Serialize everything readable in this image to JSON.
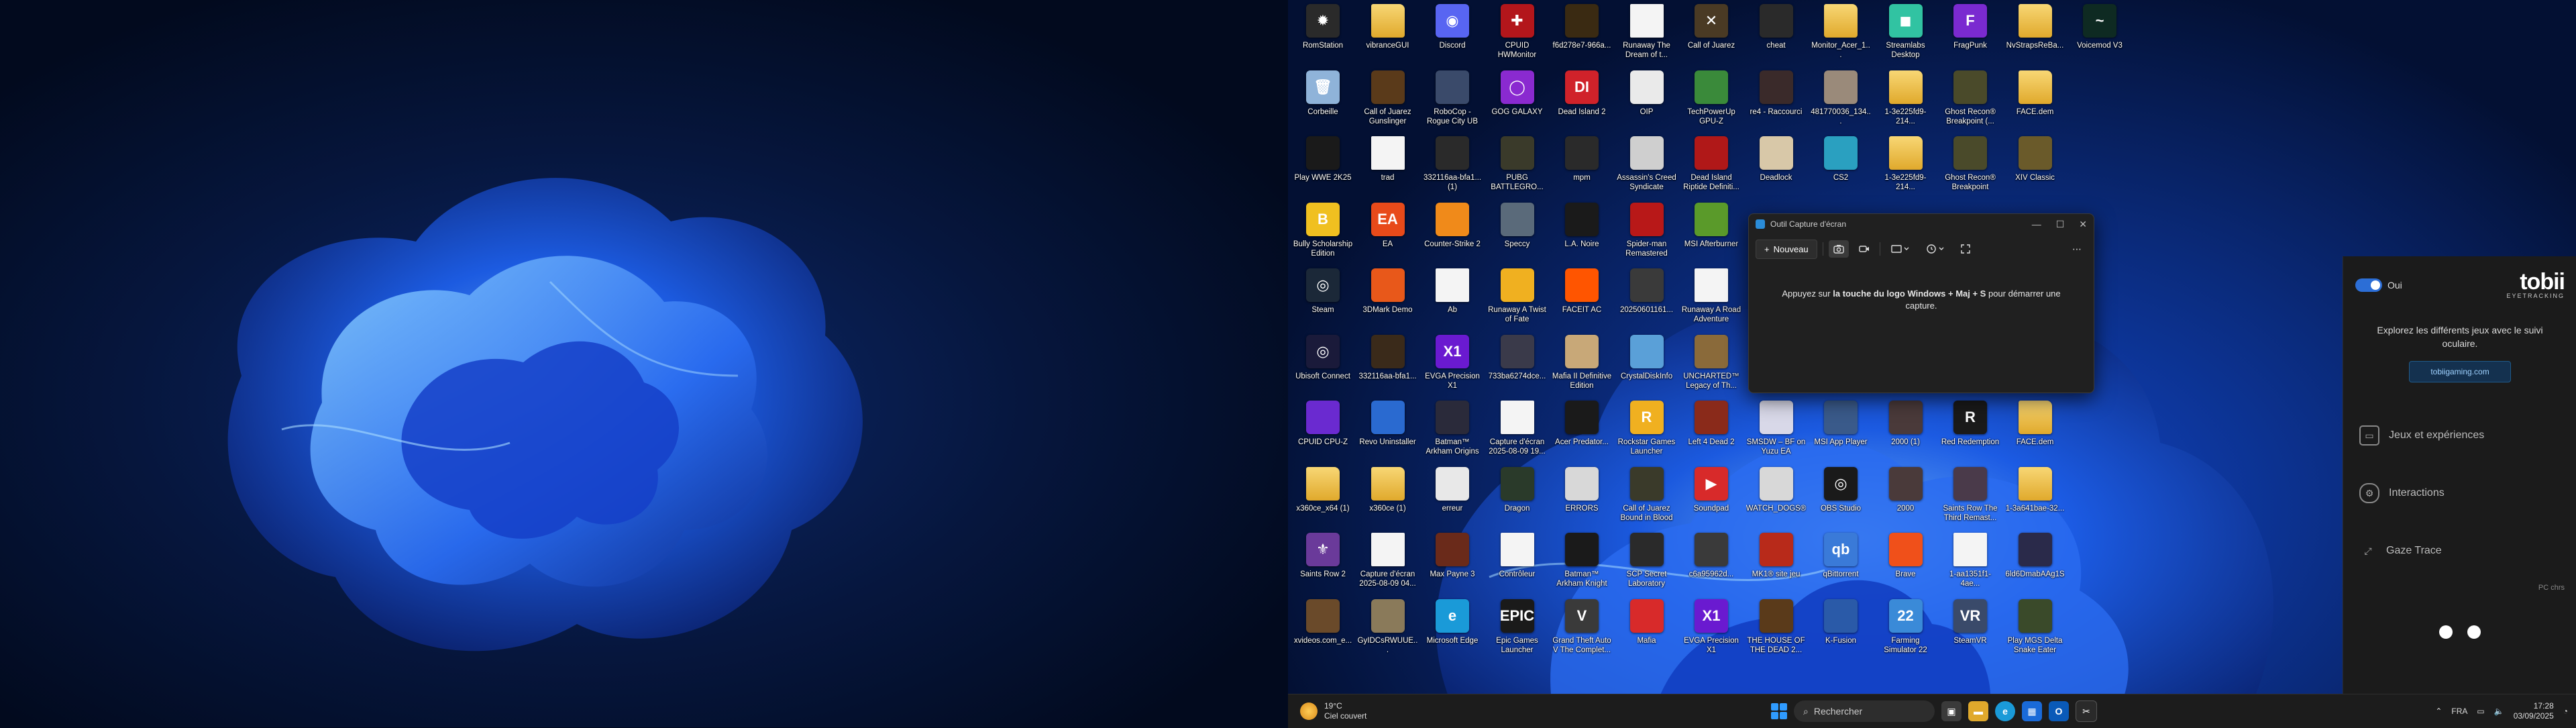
{
  "desktop_icons": [
    {
      "label": "RomStation",
      "color": "#2a2a2a",
      "glyph": "✹"
    },
    {
      "label": "vibranceGUI",
      "color": "#e0a92c",
      "glyph": "",
      "kind": "folder"
    },
    {
      "label": "Discord",
      "color": "#5865f2",
      "glyph": "◉"
    },
    {
      "label": "CPUID HWMonitor",
      "color": "#b3161b",
      "glyph": "✚"
    },
    {
      "label": "f6d278e7-966a...",
      "color": "#3a2a12",
      "glyph": ""
    },
    {
      "label": "Runaway The Dream of t...",
      "color": "#f4f4f4",
      "glyph": "",
      "kind": "doc"
    },
    {
      "label": "Call of Juarez",
      "color": "#4a3a24",
      "glyph": "✕"
    },
    {
      "label": "cheat",
      "color": "#2a2a2a",
      "glyph": ""
    },
    {
      "label": "Monitor_Acer_1...",
      "color": "#e0a92c",
      "glyph": "",
      "kind": "folder"
    },
    {
      "label": "Streamlabs Desktop",
      "color": "#31c3a2",
      "glyph": "◼"
    },
    {
      "label": "FragPunk",
      "color": "#7a2ad0",
      "glyph": "F"
    },
    {
      "label": "NvStrapsReBa...",
      "color": "#e0a92c",
      "glyph": "",
      "kind": "folder"
    },
    {
      "label": "Voicemod V3",
      "color": "#0e2a22",
      "glyph": "~"
    },
    {
      "label": "Corbeille",
      "color": "#8fb3d9",
      "glyph": "🗑"
    },
    {
      "label": "Call of Juarez Gunslinger",
      "color": "#5a3a1a",
      "glyph": ""
    },
    {
      "label": "RoboCop - Rogue City UB",
      "color": "#3a4a6a",
      "glyph": ""
    },
    {
      "label": "GOG GALAXY",
      "color": "#8a2ad0",
      "glyph": "◯"
    },
    {
      "label": "Dead Island 2",
      "color": "#d0222a",
      "glyph": "DI"
    },
    {
      "label": "OIP",
      "color": "#eaeaea",
      "glyph": ""
    },
    {
      "label": "TechPowerUp GPU-Z",
      "color": "#3a8a3a",
      "glyph": ""
    },
    {
      "label": "re4 - Raccourci",
      "color": "#3a2a2a",
      "glyph": ""
    },
    {
      "label": "481770036_134...",
      "color": "#9a8a7a",
      "glyph": ""
    },
    {
      "label": "1-3e225fd9-214...",
      "color": "#e0a92c",
      "glyph": "",
      "kind": "folder"
    },
    {
      "label": "Ghost Recon® Breakpoint (...",
      "color": "#4a4a2a",
      "glyph": ""
    },
    {
      "label": "FACE.dem",
      "color": "#e0a92c",
      "glyph": "",
      "kind": "folder"
    },
    {
      "label": "Play WWE 2K25",
      "color": "#1a1a1a",
      "glyph": ""
    },
    {
      "label": "trad",
      "color": "#f4f4f4",
      "glyph": "",
      "kind": "doc"
    },
    {
      "label": "332116aa-bfa1... (1)",
      "color": "#2a2a2a",
      "glyph": ""
    },
    {
      "label": "PUBG BATTLEGRO...",
      "color": "#3a3a2a",
      "glyph": ""
    },
    {
      "label": "mpm",
      "color": "#2a2a2a",
      "glyph": ""
    },
    {
      "label": "Assassin's Creed Syndicate",
      "color": "#cfcfcf",
      "glyph": ""
    },
    {
      "label": "Dead Island Riptide Definiti...",
      "color": "#b01818",
      "glyph": ""
    },
    {
      "label": "Deadlock",
      "color": "#d8c8a8",
      "glyph": ""
    },
    {
      "label": "CS2",
      "color": "#2aa0c0",
      "glyph": ""
    },
    {
      "label": "1-3e225fd9-214...",
      "color": "#e0a92c",
      "glyph": "",
      "kind": "folder"
    },
    {
      "label": "Ghost Recon® Breakpoint",
      "color": "#4a4a2a",
      "glyph": ""
    },
    {
      "label": "XIV Classic",
      "color": "#6a5a2a",
      "glyph": ""
    },
    {
      "label": "Bully Scholarship Edition",
      "color": "#f0c020",
      "glyph": "B"
    },
    {
      "label": "EA",
      "color": "#e84a1a",
      "glyph": "EA"
    },
    {
      "label": "Counter-Strike 2",
      "color": "#f08a1a",
      "glyph": ""
    },
    {
      "label": "Speccy",
      "color": "#5a6a7a",
      "glyph": ""
    },
    {
      "label": "L.A. Noire",
      "color": "#1a1a1a",
      "glyph": ""
    },
    {
      "label": "Spider-man Remastered",
      "color": "#b81818",
      "glyph": ""
    },
    {
      "label": "MSI Afterburner",
      "color": "#5a9a2a",
      "glyph": ""
    },
    {
      "label": "Steam",
      "color": "#1b2838",
      "glyph": "◎"
    },
    {
      "label": "3DMark Demo",
      "color": "#e8581a",
      "glyph": ""
    },
    {
      "label": "Ab",
      "color": "#f4f4f4",
      "glyph": "",
      "kind": "doc"
    },
    {
      "label": "Runaway A Twist of Fate",
      "color": "#f0b020",
      "glyph": ""
    },
    {
      "label": "FACEIT AC",
      "color": "#ff5500",
      "glyph": ""
    },
    {
      "label": "20250601161...",
      "color": "#3a3a3a",
      "glyph": ""
    },
    {
      "label": "Runaway A Road Adventure",
      "color": "#f4f4f4",
      "glyph": "",
      "kind": "doc"
    },
    {
      "label": "Ubisoft Connect",
      "color": "#1a1a3a",
      "glyph": "◎"
    },
    {
      "label": "332116aa-bfa1...",
      "color": "#3a2a1a",
      "glyph": ""
    },
    {
      "label": "EVGA Precision X1",
      "color": "#6a1ad0",
      "glyph": "X1"
    },
    {
      "label": "733ba6274dce...",
      "color": "#3a3a4a",
      "glyph": ""
    },
    {
      "label": "Mafia II Definitive Edition",
      "color": "#c8a878",
      "glyph": ""
    },
    {
      "label": "CrystalDiskInfo",
      "color": "#5aa0d8",
      "glyph": ""
    },
    {
      "label": "UNCHARTED™ Legacy of Th...",
      "color": "#8a6a3a",
      "glyph": ""
    },
    {
      "label": "CPUID CPU-Z",
      "color": "#6a2ad0",
      "glyph": ""
    },
    {
      "label": "Revo Uninstaller",
      "color": "#2a6ad0",
      "glyph": ""
    },
    {
      "label": "Batman™ Arkham Origins",
      "color": "#2a2a3a",
      "glyph": ""
    },
    {
      "label": "Capture d'écran 2025-08-09 19...",
      "color": "#f4f4f4",
      "glyph": "",
      "kind": "doc"
    },
    {
      "label": "Acer Predator...",
      "color": "#1a1a1a",
      "glyph": ""
    },
    {
      "label": "Rockstar Games Launcher",
      "color": "#f0b020",
      "glyph": "R"
    },
    {
      "label": "Left 4 Dead 2",
      "color": "#8a2a1a",
      "glyph": ""
    },
    {
      "label": "SMSDW – BF on Yuzu EA",
      "color": "#d8d8e8",
      "glyph": ""
    },
    {
      "label": "MSI App Player",
      "color": "#3a5a8a",
      "glyph": ""
    },
    {
      "label": "2000 (1)",
      "color": "#4a3a3a",
      "glyph": ""
    },
    {
      "label": "Red Redemption",
      "color": "#1a1a1a",
      "glyph": "R"
    },
    {
      "label": "FACE.dem",
      "color": "#e0a92c",
      "glyph": "",
      "kind": "folder"
    },
    {
      "label": "x360ce_x64 (1)",
      "color": "#e0a92c",
      "glyph": "",
      "kind": "folder"
    },
    {
      "label": "x360ce (1)",
      "color": "#e0a92c",
      "glyph": "",
      "kind": "folder"
    },
    {
      "label": "erreur",
      "color": "#e8e8e8",
      "glyph": ""
    },
    {
      "label": "Dragon",
      "color": "#2a3a2a",
      "glyph": ""
    },
    {
      "label": "ERRORS",
      "color": "#d8d8d8",
      "glyph": ""
    },
    {
      "label": "Call of Juarez Bound in Blood",
      "color": "#3a3a2a",
      "glyph": ""
    },
    {
      "label": "Soundpad",
      "color": "#d82a2a",
      "glyph": "▶"
    },
    {
      "label": "WATCH_DOGS®",
      "color": "#d8d8d8",
      "glyph": ""
    },
    {
      "label": "OBS Studio",
      "color": "#1a1a1a",
      "glyph": "◎"
    },
    {
      "label": "2000",
      "color": "#4a3a3a",
      "glyph": ""
    },
    {
      "label": "Saints Row The Third Remast...",
      "color": "#4a3a4a",
      "glyph": ""
    },
    {
      "label": "1-3a641bae-32...",
      "color": "#e0a92c",
      "glyph": "",
      "kind": "folder"
    },
    {
      "label": "Saints Row 2",
      "color": "#6a3a9a",
      "glyph": "⚜"
    },
    {
      "label": "Capture d'écran 2025-08-09 04...",
      "color": "#f4f4f4",
      "glyph": "",
      "kind": "doc"
    },
    {
      "label": "Max Payne 3",
      "color": "#6a2a1a",
      "glyph": ""
    },
    {
      "label": "Contrôleur",
      "color": "#f4f4f4",
      "glyph": "",
      "kind": "doc"
    },
    {
      "label": "Batman™ Arkham Knight",
      "color": "#1a1a1a",
      "glyph": ""
    },
    {
      "label": "SCP Secret Laboratory",
      "color": "#2a2a2a",
      "glyph": ""
    },
    {
      "label": "c6a95962d...",
      "color": "#3a3a3a",
      "glyph": ""
    },
    {
      "label": "MK1® site jeu",
      "color": "#b82a1a",
      "glyph": ""
    },
    {
      "label": "qBittorrent",
      "color": "#3a7ad8",
      "glyph": "qb"
    },
    {
      "label": "Brave",
      "color": "#f0501a",
      "glyph": ""
    },
    {
      "label": "1-aa1351f1-4ae...",
      "color": "#f4f4f4",
      "glyph": "",
      "kind": "doc"
    },
    {
      "label": "6ld6DmabAAg1S",
      "color": "#2a2a4a",
      "glyph": ""
    },
    {
      "label": "xvideos.com_e...",
      "color": "#6a4a2a",
      "glyph": ""
    },
    {
      "label": "GyIDCsRWUUE...",
      "color": "#8a7a5a",
      "glyph": ""
    },
    {
      "label": "Microsoft Edge",
      "color": "#1a9ad8",
      "glyph": "e"
    },
    {
      "label": "Epic Games Launcher",
      "color": "#1a1a1a",
      "glyph": "EPIC"
    },
    {
      "label": "Grand Theft Auto V The Complet...",
      "color": "#3a3a3a",
      "glyph": "V"
    },
    {
      "label": "Mafia",
      "color": "#d82a2a",
      "glyph": ""
    },
    {
      "label": "EVGA Precision X1",
      "color": "#6a1ad0",
      "glyph": "X1"
    },
    {
      "label": "THE HOUSE OF THE DEAD 2...",
      "color": "#5a3a1a",
      "glyph": ""
    },
    {
      "label": "K-Fusion",
      "color": "#2a5aa8",
      "glyph": ""
    },
    {
      "label": "Farming Simulator 22",
      "color": "#3a8ad8",
      "glyph": "22"
    },
    {
      "label": "SteamVR",
      "color": "#3a4a6a",
      "glyph": "VR"
    },
    {
      "label": "Play MGS Delta Snake Eater",
      "color": "#3a4a2a",
      "glyph": ""
    }
  ],
  "snipping_tool": {
    "title": "Outil Capture d'écran",
    "new_label": "Nouveau",
    "hint_prefix": "Appuyez sur ",
    "hint_bold": "la touche du logo Windows + Maj + S",
    "hint_suffix": " pour démarrer une capture.",
    "minimize_glyph": "—",
    "maximize_glyph": "☐",
    "close_glyph": "✕"
  },
  "tobii": {
    "toggle_label": "Oui",
    "logo": "tobii",
    "logo_sub": "EYETRACKING",
    "explore_text": "Explorez les différents jeux avec le suivi oculaire.",
    "link_label": "tobiigaming.com",
    "menu": [
      {
        "label": "Jeux et expériences",
        "icon": "controller-icon"
      },
      {
        "label": "Interactions",
        "icon": "gear-icon"
      },
      {
        "label": "Gaze Trace",
        "icon": "gaze-icon"
      }
    ],
    "pc_label": "PC chrs"
  },
  "taskbar": {
    "weather_temp": "19°C",
    "weather_desc": "Ciel couvert",
    "search_placeholder": "Rechercher",
    "lang": "FRA",
    "time": "17:28",
    "date": "03/09/2025"
  },
  "colors": {
    "accent": "#2f9bff",
    "taskbar_bg": "#1c1c1c",
    "panel_bg": "#1b1b1b"
  }
}
